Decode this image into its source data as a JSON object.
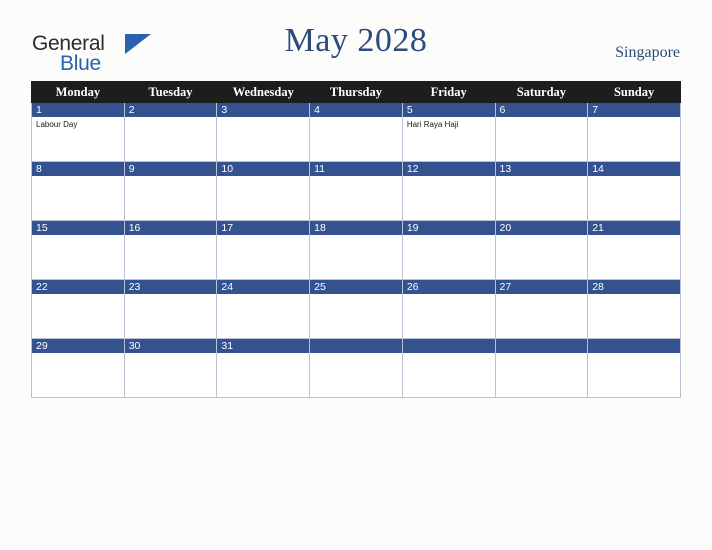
{
  "header": {
    "logo_general": "General",
    "logo_blue": "Blue",
    "title": "May 2028",
    "country": "Singapore"
  },
  "calendar": {
    "weekday_headers": [
      "Monday",
      "Tuesday",
      "Wednesday",
      "Thursday",
      "Friday",
      "Saturday",
      "Sunday"
    ],
    "weeks": [
      [
        {
          "day": "1",
          "event": "Labour Day"
        },
        {
          "day": "2",
          "event": ""
        },
        {
          "day": "3",
          "event": ""
        },
        {
          "day": "4",
          "event": ""
        },
        {
          "day": "5",
          "event": "Hari Raya Haji"
        },
        {
          "day": "6",
          "event": ""
        },
        {
          "day": "7",
          "event": ""
        }
      ],
      [
        {
          "day": "8",
          "event": ""
        },
        {
          "day": "9",
          "event": ""
        },
        {
          "day": "10",
          "event": ""
        },
        {
          "day": "11",
          "event": ""
        },
        {
          "day": "12",
          "event": ""
        },
        {
          "day": "13",
          "event": ""
        },
        {
          "day": "14",
          "event": ""
        }
      ],
      [
        {
          "day": "15",
          "event": ""
        },
        {
          "day": "16",
          "event": ""
        },
        {
          "day": "17",
          "event": ""
        },
        {
          "day": "18",
          "event": ""
        },
        {
          "day": "19",
          "event": ""
        },
        {
          "day": "20",
          "event": ""
        },
        {
          "day": "21",
          "event": ""
        }
      ],
      [
        {
          "day": "22",
          "event": ""
        },
        {
          "day": "23",
          "event": ""
        },
        {
          "day": "24",
          "event": ""
        },
        {
          "day": "25",
          "event": ""
        },
        {
          "day": "26",
          "event": ""
        },
        {
          "day": "27",
          "event": ""
        },
        {
          "day": "28",
          "event": ""
        }
      ],
      [
        {
          "day": "29",
          "event": ""
        },
        {
          "day": "30",
          "event": ""
        },
        {
          "day": "31",
          "event": ""
        },
        {
          "day": "",
          "event": ""
        },
        {
          "day": "",
          "event": ""
        },
        {
          "day": "",
          "event": ""
        },
        {
          "day": "",
          "event": ""
        }
      ]
    ]
  },
  "colors": {
    "title": "#2c4a7c",
    "header_row": "#1d1d1d",
    "day_number_bar": "#34528f",
    "cell_border": "#b9c3d4",
    "page_background": "#fcfcfa"
  }
}
